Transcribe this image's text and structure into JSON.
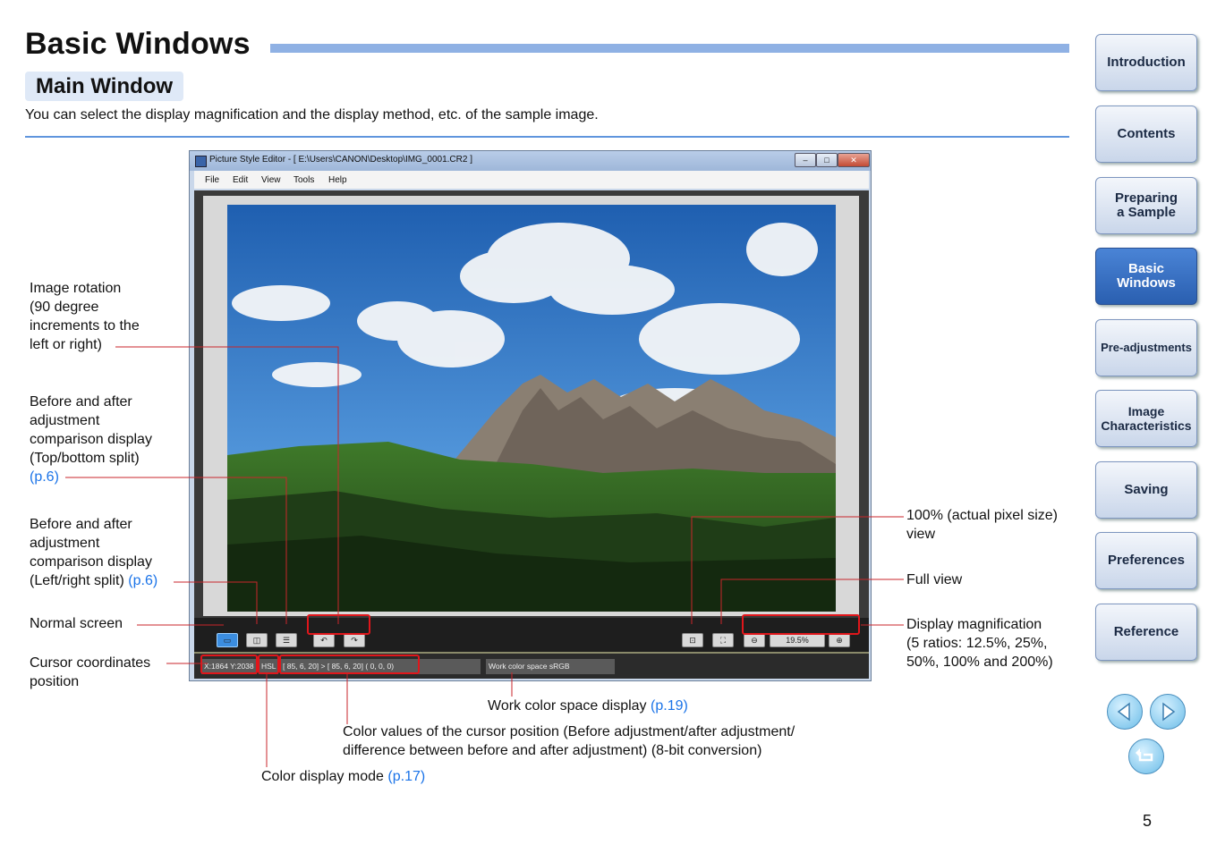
{
  "header": {
    "title": "Basic Windows",
    "section": "Main Window",
    "intro": "You can select the display magnification and the display method, etc. of the sample image."
  },
  "screenshot": {
    "window_title": "Picture Style Editor - [ E:\\Users\\CANON\\Desktop\\IMG_0001.CR2 ]",
    "menus": [
      "File",
      "Edit",
      "View",
      "Tools",
      "Help"
    ],
    "zoom_value": "19.5%",
    "cursor_coords": "X:1864 Y:2038",
    "color_mode": "HSL",
    "color_values": "[ 85,  6, 20] > [ 85,  6, 20]  (  0,  0,  0)",
    "work_color_space": "Work color space  sRGB"
  },
  "annotations": {
    "rotation": [
      "Image rotation",
      "(90 degree",
      "increments to the",
      "left or right)"
    ],
    "top_bottom": [
      "Before and after",
      "adjustment",
      "comparison display",
      "(Top/bottom split)"
    ],
    "top_bottom_ref": "(p.6)",
    "left_right": [
      "Before and after",
      "adjustment",
      "comparison display"
    ],
    "left_right_last": "(Left/right split)",
    "left_right_ref": "(p.6)",
    "normal": "Normal screen",
    "cursor": [
      "Cursor coordinates",
      "position"
    ],
    "actual_size": [
      "100% (actual pixel size)",
      "view"
    ],
    "full_view": "Full view",
    "magnification": [
      "Display magnification",
      "(5 ratios: 12.5%, 25%,",
      "50%, 100% and 200%)"
    ],
    "work_space": "Work color space display",
    "work_space_ref": "(p.19)",
    "color_values": [
      "Color values of the cursor position (Before adjustment/after adjustment/",
      "difference between before and after adjustment) (8-bit conversion)"
    ],
    "color_mode": "Color display mode",
    "color_mode_ref": "(p.17)"
  },
  "nav": [
    "Introduction",
    "Contents",
    "Preparing a Sample",
    "Basic Windows",
    "Pre-adjustments",
    "Image Characteristics",
    "Saving",
    "Preferences",
    "Reference"
  ],
  "nav_active": "Basic Windows",
  "nav_icons": [
    "previous-page-icon",
    "next-page-icon",
    "return-icon"
  ],
  "colors": {
    "accent": "#5f95dd",
    "highlight": "#e0161b",
    "link": "#1a73e8"
  },
  "page_number": "5"
}
